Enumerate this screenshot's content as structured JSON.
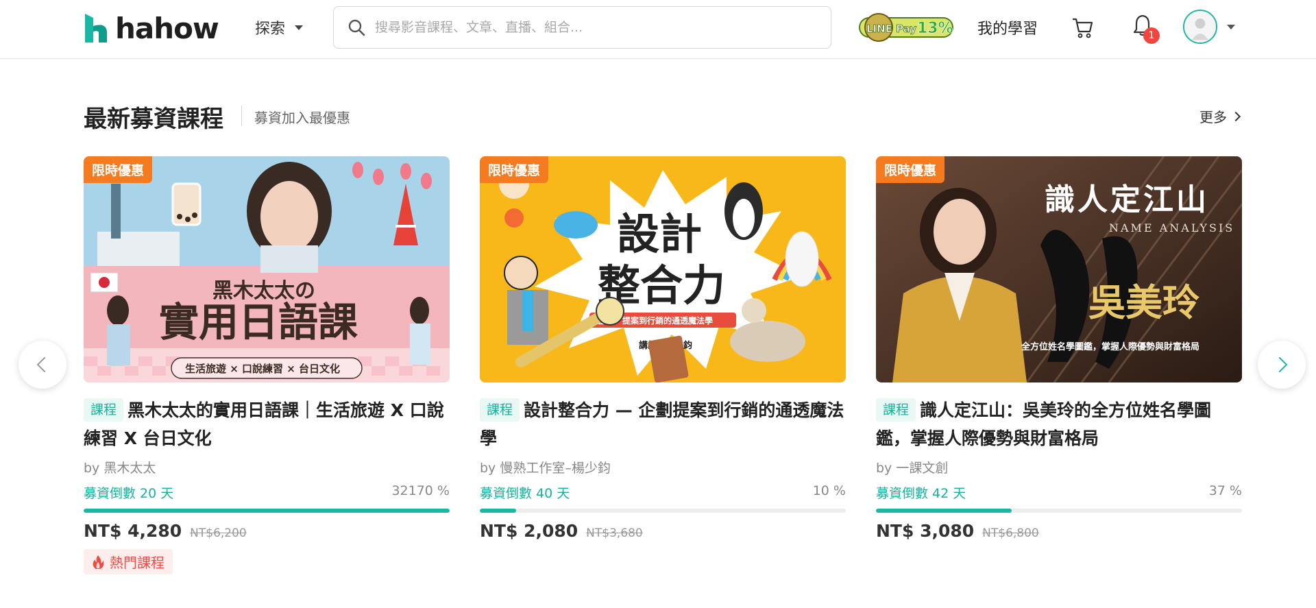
{
  "header": {
    "logo_text": "hahow",
    "explore_label": "探索",
    "search_placeholder": "搜尋影音課程、文章、直播、組合...",
    "promo_badge_text": "LINE Pay 13%",
    "my_learning_label": "我的學習",
    "notification_count": "1"
  },
  "section": {
    "title": "最新募資課程",
    "subtitle": "募資加入最優惠",
    "more_label": "更多"
  },
  "cards": [
    {
      "promo_label": "限時優惠",
      "tag": "課程",
      "title": "黑木太太的實用日語課｜生活旅遊 X 口說練習 X 台日文化",
      "thumb_caption_main": "黑木太太の",
      "thumb_caption_big": "實用日語課",
      "thumb_caption_sub": "生活旅遊 × 口說練習 × 台日文化",
      "author": "by 黑木太太",
      "fund_days": "募資倒數 20 天",
      "fund_pct_label": "32170 %",
      "progress": 1.0,
      "price": "NT$ 4,280",
      "price_old": "NT$6,200",
      "hot_label": "熱門課程"
    },
    {
      "promo_label": "限時優惠",
      "tag": "課程",
      "title": "設計整合力 — 企劃提案到行銷的通透魔法學",
      "thumb_caption_main": "設計",
      "thumb_caption_big": "整合力",
      "thumb_caption_sub": "企劃、提案到行銷的通透魔法學",
      "thumb_teacher": "講師：楊少鈞",
      "author": "by 慢熟工作室–楊少鈞",
      "fund_days": "募資倒數 40 天",
      "fund_pct_label": "10 %",
      "progress": 0.1,
      "price": "NT$ 2,080",
      "price_old": "NT$3,680"
    },
    {
      "promo_label": "限時優惠",
      "tag": "課程",
      "title": "識人定江山：吳美玲的全方位姓名學圖鑑，掌握人際優勢與財富格局",
      "thumb_caption_main": "識人定江山",
      "thumb_caption_en": "NAME ANALYSIS",
      "thumb_caption_big": "吳美玲",
      "thumb_caption_sub": "全方位姓名學圖鑑，掌握人際優勢與財富格局",
      "author": "by 一課文創",
      "fund_days": "募資倒數 42 天",
      "fund_pct_label": "37 %",
      "progress": 0.37,
      "price": "NT$ 3,080",
      "price_old": "NT$6,800"
    }
  ],
  "colors": {
    "accent": "#19b8a4",
    "promo": "#f47b20",
    "hot": "#ef4b44"
  }
}
